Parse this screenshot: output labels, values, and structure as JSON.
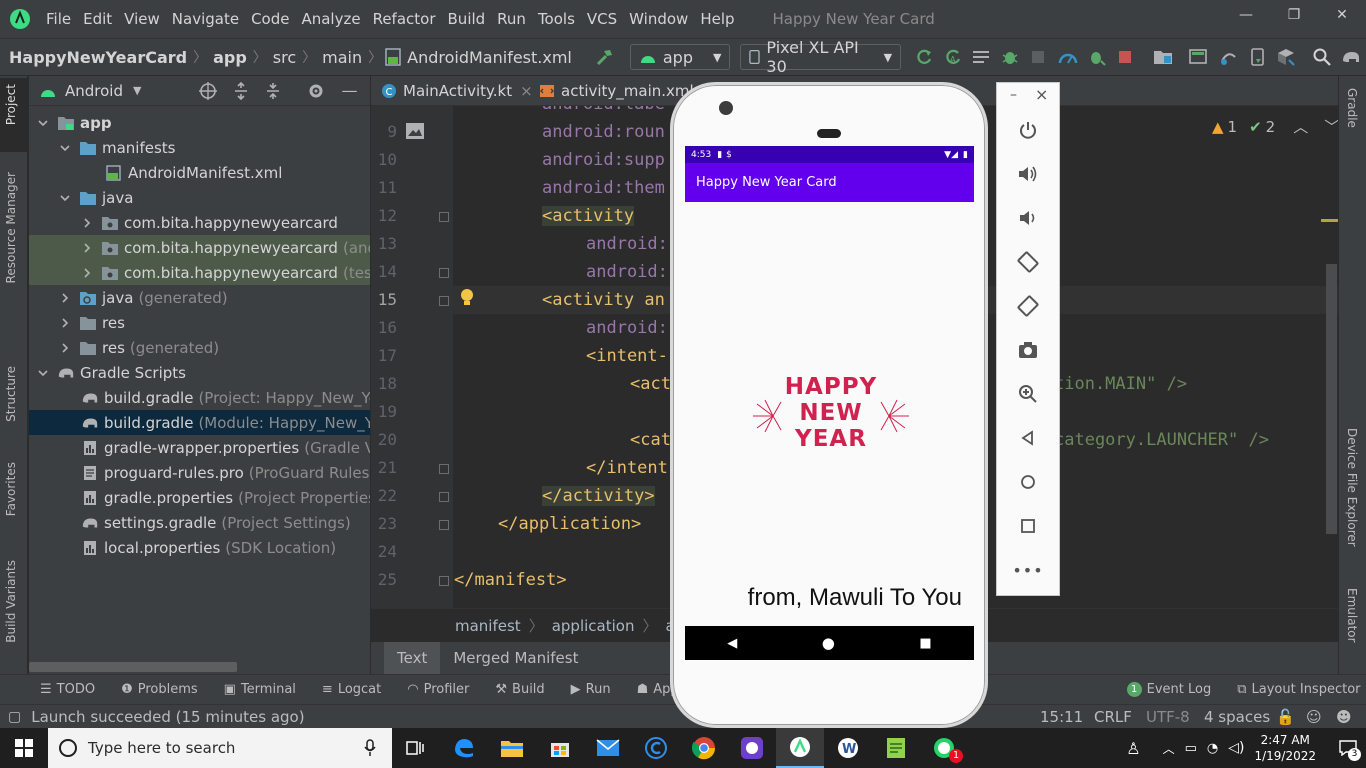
{
  "menu": {
    "items": [
      "File",
      "Edit",
      "View",
      "Navigate",
      "Code",
      "Analyze",
      "Refactor",
      "Build",
      "Run",
      "Tools",
      "VCS",
      "Window",
      "Help"
    ],
    "window_title": "Happy New Year Card"
  },
  "breadcrumb": {
    "project": "HappyNewYearCard",
    "module": "app",
    "src": "src",
    "main": "main",
    "file": "AndroidManifest.xml"
  },
  "toolbar": {
    "run_config": "app",
    "device": "Pixel XL API 30"
  },
  "left_stripe": {
    "project": "Project",
    "resource_manager": "Resource Manager",
    "structure": "Structure",
    "favorites": "Favorites",
    "build_variants": "Build Variants"
  },
  "right_stripe": {
    "gradle": "Gradle",
    "device_file_explorer": "Device File Explorer",
    "emulator": "Emulator"
  },
  "project_panel": {
    "view_mode": "Android",
    "tree": [
      {
        "label": "app",
        "hint": ""
      },
      {
        "label": "manifests",
        "hint": ""
      },
      {
        "label": "AndroidManifest.xml",
        "hint": ""
      },
      {
        "label": "java",
        "hint": ""
      },
      {
        "label": "com.bita.happynewyearcard",
        "hint": ""
      },
      {
        "label": "com.bita.happynewyearcard",
        "hint": "(andro"
      },
      {
        "label": "com.bita.happynewyearcard",
        "hint": "(test)"
      },
      {
        "label": "java",
        "hint": "(generated)"
      },
      {
        "label": "res",
        "hint": ""
      },
      {
        "label": "res",
        "hint": "(generated)"
      },
      {
        "label": "Gradle Scripts",
        "hint": ""
      },
      {
        "label": "build.gradle",
        "hint": "(Project: Happy_New_Year"
      },
      {
        "label": "build.gradle",
        "hint": "(Module: Happy_New_Yea"
      },
      {
        "label": "gradle-wrapper.properties",
        "hint": "(Gradle Ver"
      },
      {
        "label": "proguard-rules.pro",
        "hint": "(ProGuard Rules fo"
      },
      {
        "label": "gradle.properties",
        "hint": "(Project Properties)"
      },
      {
        "label": "settings.gradle",
        "hint": "(Project Settings)"
      },
      {
        "label": "local.properties",
        "hint": "(SDK Location)"
      }
    ]
  },
  "editor": {
    "tabs": [
      "MainActivity.kt",
      "activity_main.xml"
    ],
    "line_numbers": [
      "9",
      "10",
      "11",
      "12",
      "13",
      "14",
      "15",
      "16",
      "17",
      "18",
      "19",
      "20",
      "21",
      "22",
      "23",
      "24",
      "25"
    ],
    "current_line": "15",
    "inspections": {
      "warnings": "1",
      "weak_warnings": "2"
    },
    "code": {
      "l8": "android:labe",
      "l9": "android:roun",
      "l10": "android:supp",
      "l11": "android:them",
      "l12": "<activity",
      "l13": "android:",
      "l14": "android:",
      "l15": "<activity an",
      "l16": "android:",
      "l17": "<intent-",
      "l18a": "<act",
      "l18b": "tion.MAIN\" />",
      "l20a": "<cat",
      "l20b": "category.LAUNCHER\" />",
      "l21": "</intent",
      "l22": "</activity>",
      "l23": "</application>",
      "l25": "</manifest>"
    },
    "breadcrumb": [
      "manifest",
      "application",
      "activ"
    ],
    "bottom_tabs": [
      "Text",
      "Merged Manifest"
    ]
  },
  "tool_windows": [
    "TODO",
    "Problems",
    "Terminal",
    "Logcat",
    "Profiler",
    "Build",
    "Run",
    "App I"
  ],
  "tool_windows_right": {
    "event_log_count": "1",
    "event_log": "Event Log",
    "layout_inspector": "Layout Inspector"
  },
  "status": {
    "message": "Launch succeeded (15 minutes ago)",
    "position": "15:11",
    "line_sep": "CRLF",
    "encoding": "UTF-8",
    "indent": "4 spaces"
  },
  "emulator": {
    "time": "4:53",
    "app_title": "Happy New Year Card",
    "greeting_line1": "HAPPY",
    "greeting_line2": "NEW",
    "greeting_line3": "YEAR",
    "signature": "from, Mawuli To You",
    "close": "×",
    "minimize": "–"
  },
  "taskbar": {
    "search_placeholder": "Type here to search",
    "clock_time": "2:47 AM",
    "clock_date": "1/19/2022",
    "notification_count": "3",
    "whatsapp_badge": "1"
  },
  "colors": {
    "ide_bg": "#2b2b2b",
    "panel_bg": "#3c3f41",
    "app_primary": "#6200ee",
    "app_status": "#3700b3",
    "greeting_red": "#d0214f"
  }
}
